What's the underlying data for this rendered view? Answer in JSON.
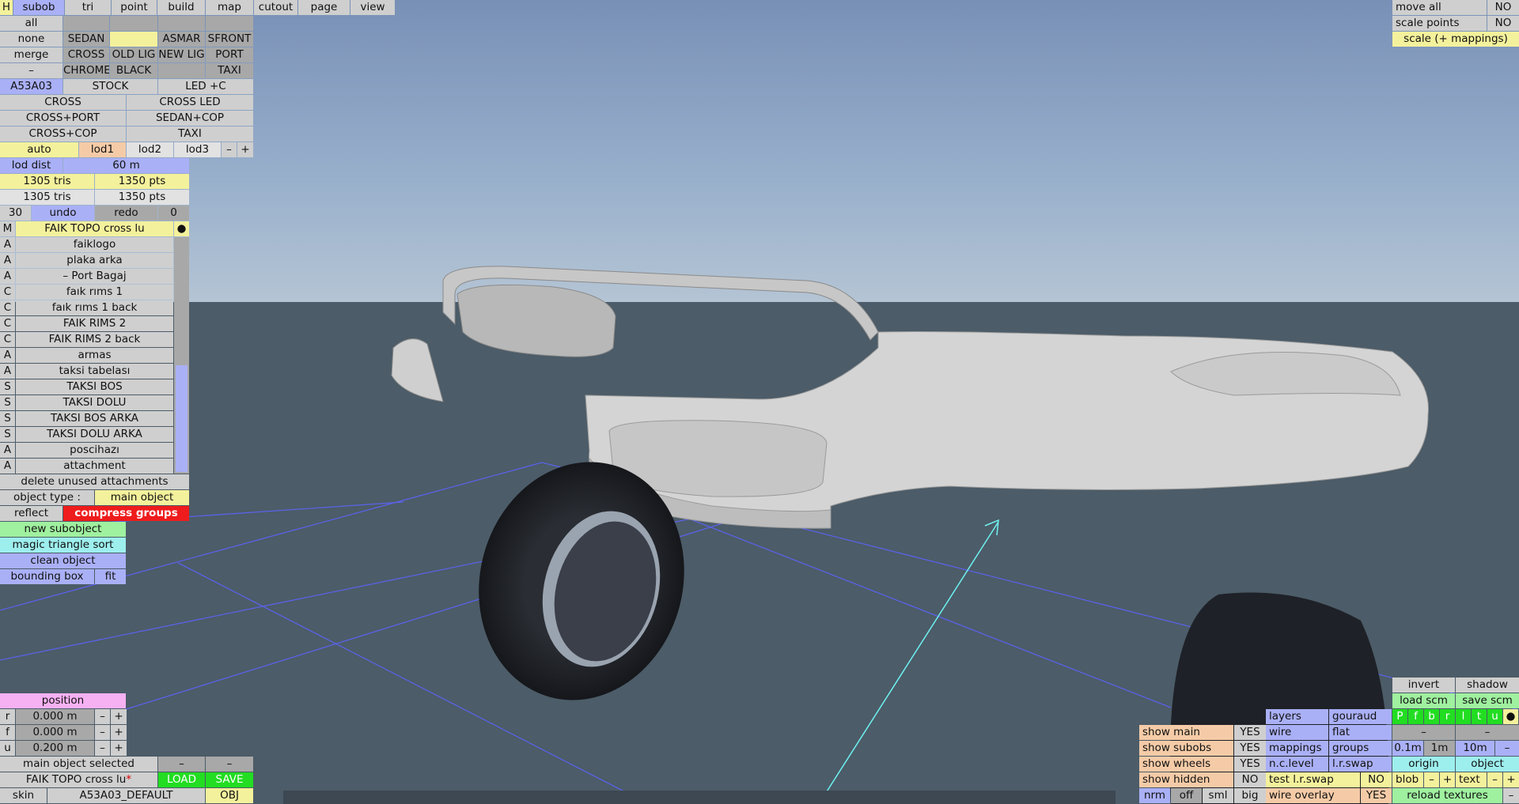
{
  "topbar": {
    "h": "H",
    "tabs": [
      "subob",
      "tri",
      "point",
      "build",
      "map",
      "cutout",
      "page",
      "view"
    ]
  },
  "variants": {
    "row1": [
      "all",
      "",
      "",
      "",
      ""
    ],
    "row2": [
      "none",
      "SEDAN",
      "",
      "ASMAR",
      "SFRONT"
    ],
    "row3": [
      "merge",
      "CROSS",
      "OLD LIG",
      "NEW LIG",
      "PORT"
    ],
    "row4": [
      "–",
      "CHROME",
      "BLACK",
      "",
      "TAXI"
    ],
    "row5": [
      "A53A03",
      "STOCK",
      "LED +C"
    ],
    "combos": [
      "CROSS",
      "CROSS LED",
      "CROSS+PORT",
      "SEDAN+COP",
      "CROSS+COP",
      "TAXI"
    ]
  },
  "lod": {
    "items": [
      "auto",
      "lod1",
      "lod2",
      "lod3"
    ],
    "minus": "–",
    "plus": "+",
    "dist_label": "lod dist",
    "dist_value": "60 m"
  },
  "stats": {
    "tris1": "1305 tris",
    "pts1": "1350 pts",
    "tris2": "1305 tris",
    "pts2": "1350 pts"
  },
  "history": {
    "count": "30",
    "undo": "undo",
    "redo": "redo",
    "redo_count": "0"
  },
  "list": {
    "header": {
      "m": "M",
      "name": "FAIK TOPO cross lu",
      "dot": "●"
    },
    "items": [
      {
        "t": "A",
        "name": "faiklogo"
      },
      {
        "t": "A",
        "name": "plaka arka"
      },
      {
        "t": "A",
        "name": "– Port Bagaj"
      },
      {
        "t": "C",
        "name": "faık rıms 1"
      },
      {
        "t": "C",
        "name": "faık rıms 1 back"
      },
      {
        "t": "C",
        "name": "FAIK RIMS 2"
      },
      {
        "t": "C",
        "name": "FAIK RIMS 2 back"
      },
      {
        "t": "A",
        "name": "armas"
      },
      {
        "t": "A",
        "name": "taksi tabelası"
      },
      {
        "t": "S",
        "name": "TAKSI BOS"
      },
      {
        "t": "S",
        "name": "TAKSI DOLU"
      },
      {
        "t": "S",
        "name": "TAKSI BOS ARKA"
      },
      {
        "t": "S",
        "name": "TAKSI DOLU ARKA"
      },
      {
        "t": "A",
        "name": "poscihazı"
      },
      {
        "t": "A",
        "name": "attachment"
      }
    ]
  },
  "actions": {
    "delete_unused": "delete unused attachments",
    "object_type_label": "object type :",
    "object_type_value": "main object",
    "reflect": "reflect",
    "compress": "compress groups",
    "new_subobject": "new subobject",
    "magic_sort": "magic triangle sort",
    "clean": "clean object",
    "bounding": "bounding box",
    "fit": "fit"
  },
  "position": {
    "title": "position",
    "rows": [
      {
        "axis": "r",
        "value": "0.000 m"
      },
      {
        "axis": "f",
        "value": "0.000 m"
      },
      {
        "axis": "u",
        "value": "0.200 m"
      }
    ],
    "minus": "–",
    "plus": "+"
  },
  "bottom_left": {
    "selected": "main object selected",
    "dash1": "–",
    "dash2": "–",
    "file": "FAIK TOPO cross lu",
    "star": "*",
    "load": "LOAD",
    "save": "SAVE",
    "skin_label": "skin",
    "skin_value": "A53A03_DEFAULT",
    "obj": "OBJ"
  },
  "top_right": {
    "move_all": "move all",
    "move_all_v": "NO",
    "scale_points": "scale points",
    "scale_points_v": "NO",
    "scale_mappings": "scale (+ mappings)"
  },
  "bottom_right": {
    "show": [
      {
        "label": "show main",
        "v": "YES"
      },
      {
        "label": "show subobs",
        "v": "YES"
      },
      {
        "label": "show wheels",
        "v": "YES"
      },
      {
        "label": "show hidden",
        "v": "NO"
      }
    ],
    "nrm": "nrm",
    "off": "off",
    "sml": "sml",
    "big": "big",
    "layers": "layers",
    "gouraud": "gouraud",
    "wire": "wire",
    "flat": "flat",
    "mappings": "mappings",
    "groups": "groups",
    "nclevel": "n.c.level",
    "lrswap": "l.r.swap",
    "test_lrswap": "test l.r.swap",
    "test_v": "NO",
    "wire_overlay": "wire overlay",
    "wire_overlay_v": "YES",
    "invert": "invert",
    "shadow": "shadow",
    "load_scm": "load scm",
    "save_scm": "save scm",
    "pfbrltu": [
      "P",
      "f",
      "b",
      "r",
      "l",
      "t",
      "u",
      "●"
    ],
    "dash": "–",
    "dist": [
      "0.1m",
      "1m",
      "10m",
      "–"
    ],
    "origin": "origin",
    "object": "object",
    "blob": "blob",
    "minus": "–",
    "plus": "+",
    "text": "text",
    "reload": "reload textures"
  }
}
